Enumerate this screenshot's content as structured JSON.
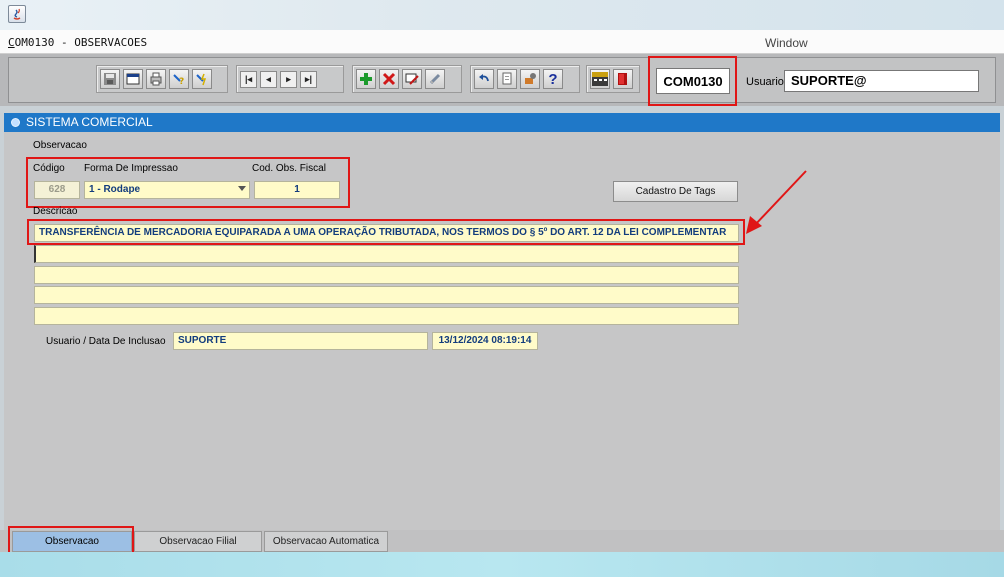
{
  "app": {
    "window_title_prefix": "C",
    "window_title_rest": "OM0130 - OBSERVACOES",
    "window_menu": "Window"
  },
  "toolbar": {
    "screen_code": "COM0130",
    "usuario_label": "Usuario",
    "usuario_value": "SUPORTE@",
    "icons": [
      "save-icon",
      "window-icon",
      "print-icon",
      "query-icon",
      "execute-query-icon",
      "first-record-icon",
      "previous-record-icon",
      "next-record-icon",
      "last-record-icon",
      "insert-record-icon",
      "delete-record-icon",
      "edit-record-icon",
      "clear-icon",
      "undo-icon",
      "copy-icon",
      "tools-icon",
      "help-icon",
      "calendar-icon",
      "exit-icon"
    ],
    "nav_glyphs": [
      "|◂",
      "◂",
      "▸",
      "▸|"
    ],
    "help_glyph": "?"
  },
  "section": {
    "title": "SISTEMA COMERCIAL"
  },
  "form": {
    "group_label": "Observacao",
    "codigo_label": "Código",
    "codigo_value": "628",
    "forma_label": "Forma De Impressao",
    "forma_value": "1 - Rodape",
    "cod_obs_label": "Cod. Obs. Fiscal",
    "cod_obs_value": "1",
    "tags_button": "Cadastro De Tags",
    "descricao_label": "Descricao",
    "descricao_lines": [
      "TRANSFERÊNCIA DE MERCADORIA EQUIPARADA A UMA OPERAÇÃO TRIBUTADA, NOS TERMOS DO § 5º DO ART. 12 DA LEI COMPLEMENTAR",
      "",
      "",
      "",
      ""
    ],
    "usuario_data_label": "Usuario / Data De Inclusao",
    "usuario_inclusao": "SUPORTE",
    "data_inclusao": "13/12/2024 08:19:14"
  },
  "tabs": [
    {
      "label": "Observacao",
      "active": true
    },
    {
      "label": "Observacao Filial",
      "active": false
    },
    {
      "label": "Observacao Automatica",
      "active": false
    }
  ],
  "colors": {
    "highlight": "#e01616",
    "section_bar": "#1f78c8",
    "field_bg": "#fffbc9",
    "field_text": "#123c7d"
  }
}
